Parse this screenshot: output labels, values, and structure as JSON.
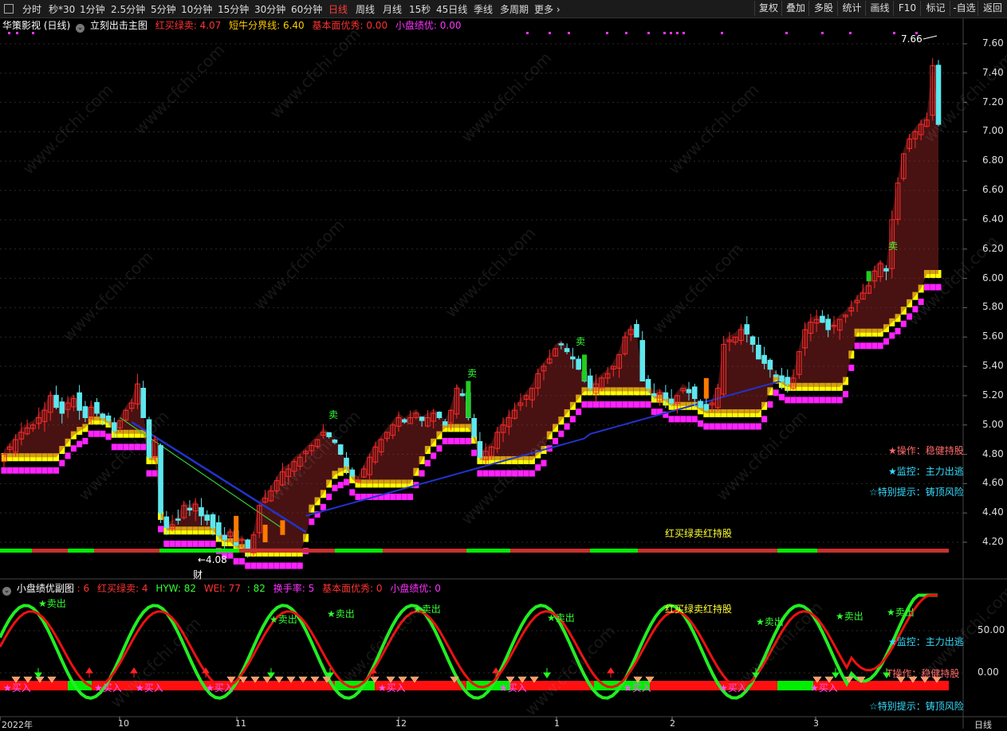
{
  "toolbar": {
    "periods": [
      "分时",
      "秒*30",
      "1分钟",
      "2.5分钟",
      "5分钟",
      "10分钟",
      "15分钟",
      "30分钟",
      "60分钟",
      "日线",
      "周线",
      "月线",
      "15秒",
      "45日线",
      "季线",
      "多周期",
      "更多 ›"
    ],
    "active_period": "日线",
    "right_buttons": [
      "复权",
      "叠加",
      "多股",
      "统计",
      "画线",
      "F10",
      "标记",
      "-自选",
      "返回"
    ]
  },
  "main_header": {
    "stock": "华策影视 (日线)",
    "indicator": "立刻出击主图",
    "hongmai_label": "红买绿卖: 4.07",
    "duanniu_label": "短牛分界线: 6.40",
    "jiben_label": "基本面优秀: 0.00",
    "xiaopan_label": "小盘绩优: 0.00"
  },
  "sub_header": {
    "name": "小盘绩优副图",
    "v1": ": 6",
    "hongmai": "红买绿卖: 4",
    "hyw": "HYW: 82",
    "wei": "WEI: 77",
    "wei2": ": 82",
    "huanshou": "换手率: 5",
    "jiben": "基本面优秀: 0",
    "xiaopan": "小盘绩优: 0"
  },
  "price_axis": [
    "7.60",
    "7.40",
    "7.20",
    "7.00",
    "6.80",
    "6.60",
    "6.40",
    "6.20",
    "6.00",
    "5.80",
    "5.60",
    "5.40",
    "5.20",
    "5.00",
    "4.80",
    "4.60",
    "4.40",
    "4.20"
  ],
  "sub_axis": [
    "50.00",
    "0.00"
  ],
  "time_axis": [
    "2022年",
    "10",
    "11",
    "12",
    "1",
    "2",
    "3"
  ],
  "period_label": "日线",
  "annotations": {
    "high_price": "7.66",
    "low_price": "←4.08",
    "cai": "财",
    "main_center": "红买绿卖红持股",
    "sub_center": "红买绿卖红持股",
    "op_main": "★操作：稳健持股",
    "monitor_main": "★监控：主力出逃",
    "special_main": "☆特别提示：铸顶风险",
    "monitor_sub": "★监控：主力出逃",
    "op_sub": "T操作：稳健持股",
    "special_sub": "☆特别提示：铸顶风险",
    "sell_tag": "★卖出",
    "buy_tag": "★买入",
    "mai": "卖",
    "watermark": "www.cfchi.com"
  },
  "colors": {
    "up": "#ff2a2a",
    "down": "#5de8ee",
    "yellow": "#ffff00",
    "magenta": "#ff22ff",
    "green": "#00ee00",
    "blue": "#1e2ea8",
    "gold": "#e8c000",
    "cyan_text": "#33ddff",
    "op_text": "#ff6a6a"
  },
  "chart_data": {
    "type": "candlestick",
    "y_range": [
      4.08,
      7.66
    ],
    "closes": [
      4.8,
      4.85,
      4.9,
      4.95,
      4.98,
      5.0,
      5.05,
      5.1,
      5.2,
      5.12,
      5.08,
      5.15,
      5.18,
      5.1,
      5.05,
      5.12,
      5.08,
      5.05,
      5.03,
      4.96,
      5.03,
      5.1,
      5.15,
      5.28,
      5.05,
      4.78,
      4.9,
      4.4,
      4.3,
      4.32,
      4.35,
      4.45,
      4.42,
      4.46,
      4.38,
      4.35,
      4.3,
      4.25,
      4.22,
      4.27,
      4.18,
      4.22,
      4.15,
      4.25,
      4.45,
      4.5,
      4.55,
      4.62,
      4.68,
      4.7,
      4.75,
      4.78,
      4.82,
      4.86,
      4.9,
      4.95,
      4.92,
      4.88,
      4.8,
      4.72,
      4.65,
      4.62,
      4.7,
      4.78,
      4.85,
      4.9,
      4.95,
      5.0,
      5.05,
      5.02,
      5.05,
      5.08,
      5.03,
      5.05,
      5.08,
      5.05,
      5.0,
      5.1,
      5.25,
      5.2,
      5.05,
      4.92,
      4.78,
      4.82,
      4.85,
      4.95,
      5.0,
      5.05,
      5.1,
      5.15,
      5.2,
      5.25,
      5.35,
      5.4,
      5.45,
      5.52,
      5.55,
      5.5,
      5.45,
      5.38,
      5.3,
      5.25,
      5.28,
      5.32,
      5.35,
      5.4,
      5.48,
      5.6,
      5.65,
      5.6,
      5.3,
      5.25,
      5.2,
      5.22,
      5.18,
      5.15,
      5.2,
      5.25,
      5.22,
      5.18,
      5.12,
      5.1,
      5.15,
      5.25,
      5.55,
      5.58,
      5.6,
      5.65,
      5.62,
      5.55,
      5.45,
      5.42,
      5.38,
      5.33,
      5.3,
      5.28,
      5.32,
      5.5,
      5.65,
      5.7,
      5.72,
      5.7,
      5.65,
      5.68,
      5.72,
      5.75,
      5.8,
      5.85,
      5.9,
      5.95,
      6.05,
      6.1,
      6.05,
      6.4,
      6.65,
      6.85,
      6.95,
      7.0,
      7.05,
      7.08,
      7.45,
      7.05
    ]
  }
}
